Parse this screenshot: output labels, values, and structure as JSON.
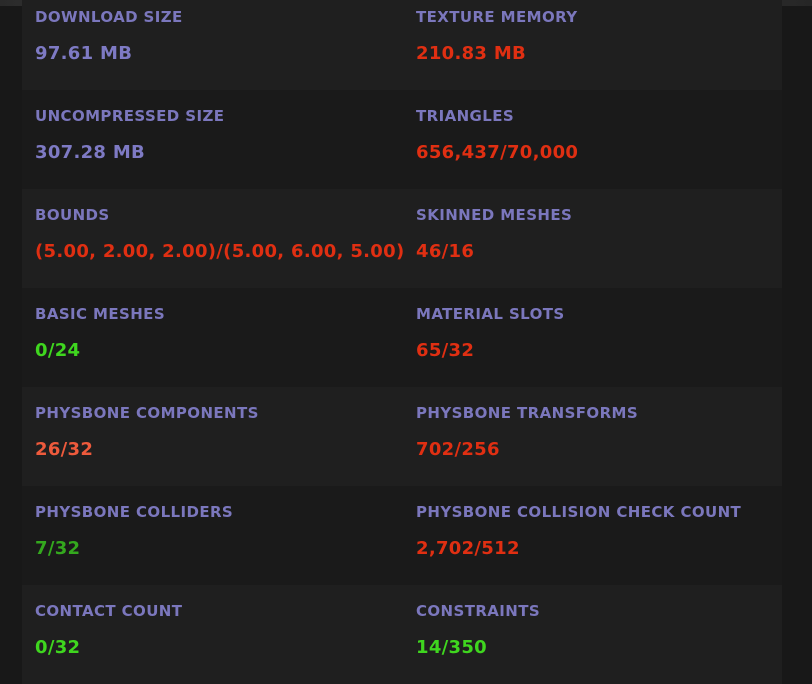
{
  "colors": {
    "background": "#181818",
    "label": "#7b77bd",
    "value_neutral": "#7e7ac4",
    "value_bad": "#e02f12",
    "value_good": "#3fd61f",
    "value_warn": "#ee5a3c",
    "value_ok": "#34a81e"
  },
  "stats": {
    "download_size": {
      "label": "DOWNLOAD SIZE",
      "value": "97.61 MB",
      "status": "neutral"
    },
    "texture_memory": {
      "label": "TEXTURE MEMORY",
      "value": "210.83 MB",
      "status": "bad"
    },
    "uncompressed_size": {
      "label": "UNCOMPRESSED SIZE",
      "value": "307.28 MB",
      "status": "neutral"
    },
    "triangles": {
      "label": "TRIANGLES",
      "value": "656,437/70,000",
      "status": "bad"
    },
    "bounds": {
      "label": "BOUNDS",
      "value": "(5.00, 2.00, 2.00)/(5.00, 6.00, 5.00)",
      "status": "bad"
    },
    "skinned_meshes": {
      "label": "SKINNED MESHES",
      "value": "46/16",
      "status": "bad"
    },
    "basic_meshes": {
      "label": "BASIC MESHES",
      "value": "0/24",
      "status": "good"
    },
    "material_slots": {
      "label": "MATERIAL SLOTS",
      "value": "65/32",
      "status": "bad"
    },
    "physbone_components": {
      "label": "PHYSBONE COMPONENTS",
      "value": "26/32",
      "status": "warn"
    },
    "physbone_transforms": {
      "label": "PHYSBONE TRANSFORMS",
      "value": "702/256",
      "status": "bad"
    },
    "physbone_colliders": {
      "label": "PHYSBONE COLLIDERS",
      "value": "7/32",
      "status": "ok"
    },
    "physbone_collision_check_count": {
      "label": "PHYSBONE COLLISION CHECK COUNT",
      "value": "2,702/512",
      "status": "bad"
    },
    "contact_count": {
      "label": "CONTACT COUNT",
      "value": "0/32",
      "status": "good"
    },
    "constraints": {
      "label": "CONSTRAINTS",
      "value": "14/350",
      "status": "good"
    }
  }
}
